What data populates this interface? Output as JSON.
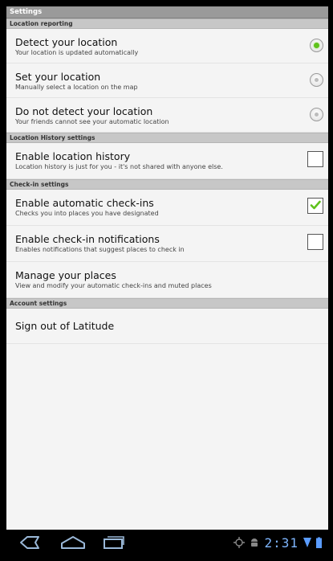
{
  "app": {
    "title": "Settings"
  },
  "sections": {
    "location_reporting": "Location reporting",
    "location_history": "Location History settings",
    "checkin": "Check-in settings",
    "account": "Account settings"
  },
  "rows": {
    "detect": {
      "title": "Detect your location",
      "subtitle": "Your location is updated automatically",
      "selected": true
    },
    "set": {
      "title": "Set your location",
      "subtitle": "Manually select a location on the map",
      "selected": false
    },
    "nodetect": {
      "title": "Do not detect your location",
      "subtitle": "Your friends cannot see your automatic location",
      "selected": false
    },
    "history": {
      "title": "Enable location history",
      "subtitle": "Location history is just for you - it's not shared with anyone else.",
      "checked": false
    },
    "auto_checkin": {
      "title": "Enable automatic check-ins",
      "subtitle": "Checks you into places you have designated",
      "checked": true
    },
    "checkin_notifications": {
      "title": "Enable check-in notifications",
      "subtitle": "Enables notifications that suggest places to check in",
      "checked": false
    },
    "manage_places": {
      "title": "Manage your places",
      "subtitle": "View and modify your automatic check-ins and muted places"
    },
    "sign_out": {
      "title": "Sign out of Latitude"
    }
  },
  "statusbar": {
    "time": "2:31"
  },
  "colors": {
    "accent_green": "#5fc21b",
    "clock_blue": "#7fb6ff",
    "header_gray": "#9a9a9a",
    "section_gray": "#c7c7c7"
  },
  "icons": [
    "back-icon",
    "home-icon",
    "recent-apps-icon",
    "gps-icon",
    "android-debug-icon",
    "signal-icon",
    "battery-icon"
  ]
}
